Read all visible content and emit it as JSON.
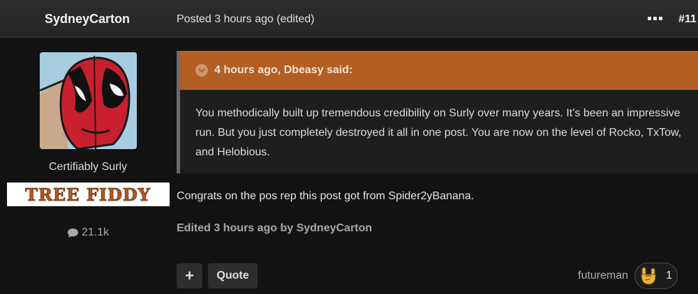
{
  "post": {
    "author": "SydneyCarton",
    "posted": "Posted 3 hours ago (edited)",
    "number": "#11"
  },
  "profile": {
    "rank": "Certifiably Surly",
    "badge_text": "TREE FIDDY",
    "post_count": "21.1k",
    "icons": {
      "posts": "speech-bubble-icon"
    }
  },
  "quote": {
    "header": "4 hours ago, Dbeasy said:",
    "body": "You methodically built up tremendous credibility on Surly over many years. It’s been an impressive run. But you just completely destroyed it all in one post. You are now on the level of Rocko, TxTow, and Helobious."
  },
  "reply": "Congrats on the pos rep this post got from Spider2yBanana.",
  "edited": "Edited 3 hours ago by SydneyCarton",
  "actions": {
    "plus": "+",
    "quote": "Quote"
  },
  "reactions": {
    "user": "futureman",
    "icon": "rock-on-hand-icon",
    "count": "1"
  },
  "colors": {
    "background": "#121213",
    "header": "#2c2c2e",
    "quote_accent": "#b35e22",
    "badge_text": "#b5581e"
  }
}
